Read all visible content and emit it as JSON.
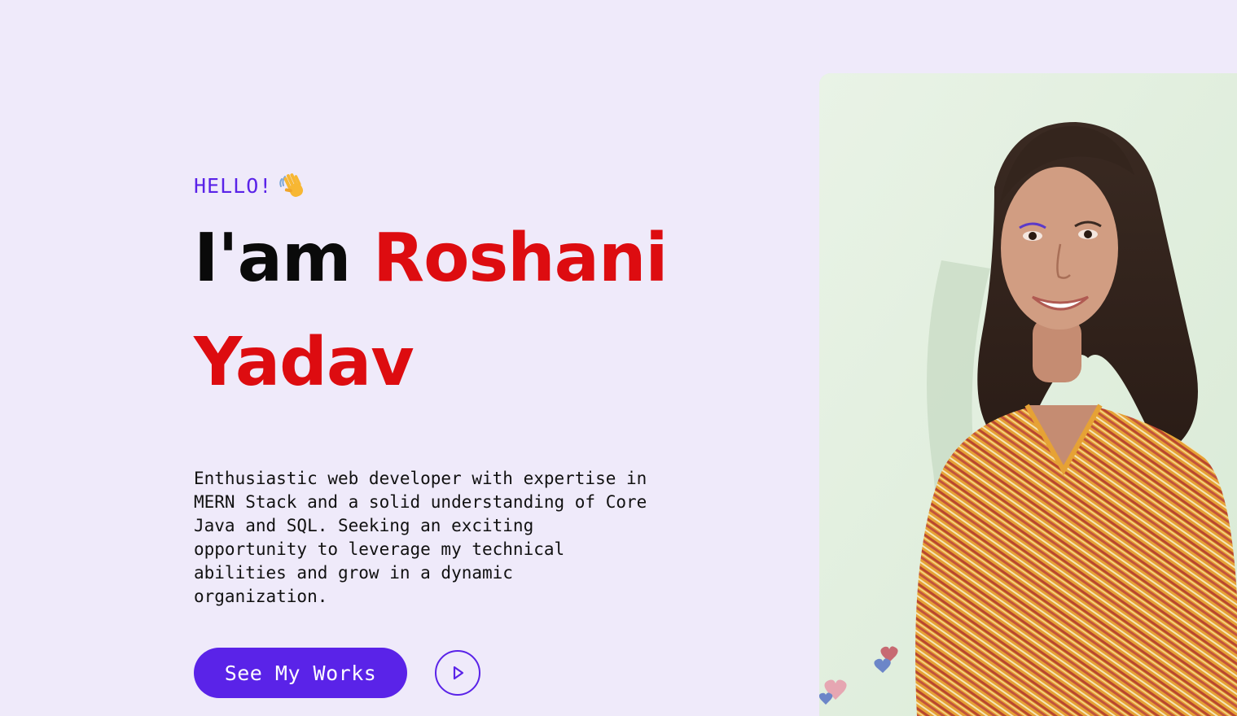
{
  "hero": {
    "greeting": "HELLO!",
    "greeting_emoji": "waving-hand-icon",
    "headline_prefix": "I'am",
    "headline_name_first": "Roshani",
    "headline_name_last": "Yadav",
    "bio": "Enthusiastic web developer with expertise in MERN Stack and a solid understanding of Core Java and SQL. Seeking an exciting opportunity to leverage my technical abilities and grow in a dynamic organization.",
    "cta_label": "See My Works",
    "play_icon": "play-icon"
  },
  "portrait": {
    "alt": "Portrait photo"
  },
  "colors": {
    "background": "#efeafa",
    "accent_purple": "#5a23e8",
    "name_red": "#dd0c10",
    "text_dark": "#0a0a0a"
  }
}
